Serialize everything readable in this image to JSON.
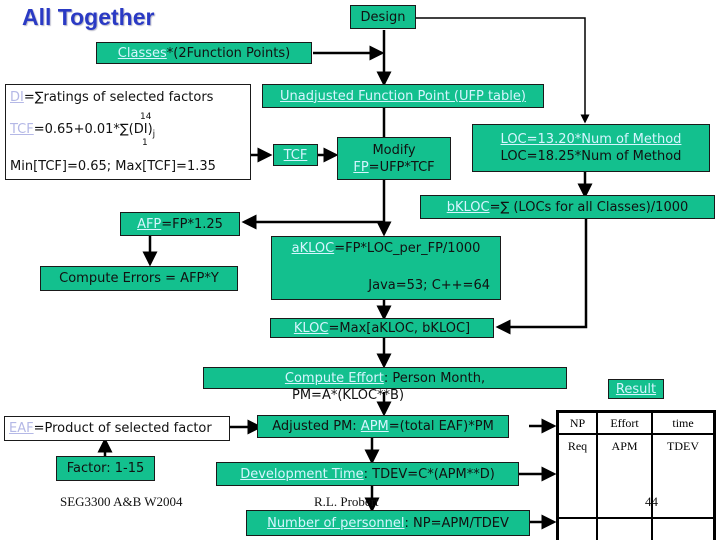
{
  "title": "All Together",
  "boxes": {
    "design": "Design",
    "classes": {
      "link": "Classes",
      "rest": "*(2Function Points)"
    },
    "di": {
      "link": "DI",
      "rest": "=∑ratings of selected factors"
    },
    "tcf_formula": {
      "link": "TCF",
      "rest": "=0.65+0.01*∑(DI)",
      "subscript": "j",
      "sum_upper": "14",
      "sum_lower": "1"
    },
    "tcf_range": "Min[TCF]=0.65; Max[TCF]=1.35",
    "ufp": {
      "link": "Unadjusted Function Point (UFP table)"
    },
    "tcf": {
      "link": "TCF"
    },
    "modify": {
      "line1": "Modify",
      "link": "FP",
      "rest": "=UFP*TCF"
    },
    "loc": {
      "link": "LOC=13.20*Num of Method",
      "line2": "LOC=18.25*Num of Method"
    },
    "bkloc": {
      "link": "bKLOC",
      "rest": "=∑ (LOCs for all Classes)/1000"
    },
    "afp": {
      "link": "AFP",
      "rest": "=FP*1.25"
    },
    "errors": "Compute Errors = AFP*Y",
    "akloc": {
      "link": "aKLOC",
      "rest": "=FP*LOC_per_FP/1000",
      "line2": "Java=53; C++=64"
    },
    "kloc": {
      "link": "KLOC",
      "rest": "=Max[aKLOC, bKLOC]"
    },
    "effort": {
      "link": "Compute Effort",
      "rest": ": Person Month,",
      "line2": "PM=A*(KLOC**B)"
    },
    "eaf": {
      "link": "EAF",
      "rest": "=Product of selected factor"
    },
    "factor": "Factor: 1-15",
    "apm": {
      "prefix": "Adjusted PM: ",
      "link": "APM",
      "rest": "=(total EAF)*PM"
    },
    "tdev": {
      "link": "Development Time",
      "rest": ": TDEV=C*(APM**D)"
    },
    "np": {
      "link": "Number of personnel",
      "rest": ": NP=APM/TDEV"
    },
    "result": {
      "link": "Result"
    }
  },
  "result_table": {
    "headers": [
      "NP",
      "Effort",
      "time"
    ],
    "row": [
      "Req",
      "APM",
      "TDEV"
    ]
  },
  "footer": {
    "course": "SEG3300 A&B W2004",
    "author": "R.L. Probert",
    "page": "44"
  }
}
